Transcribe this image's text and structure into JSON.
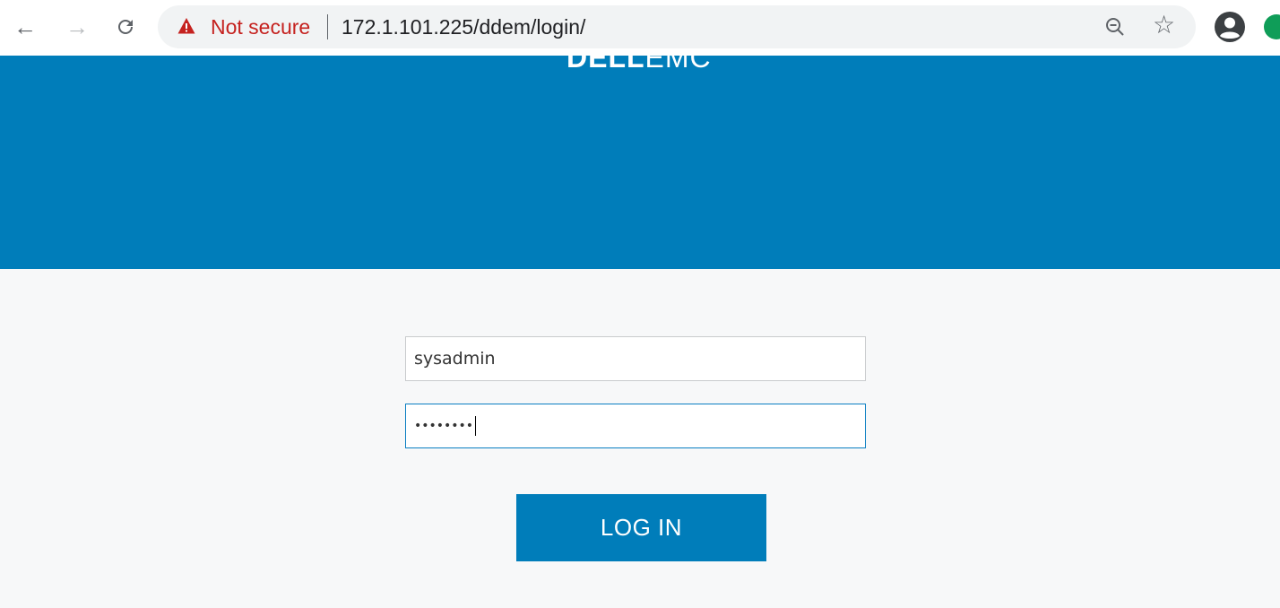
{
  "browser": {
    "back_icon": "arrow-left-icon",
    "forward_icon": "arrow-right-icon",
    "reload_icon": "reload-icon",
    "security_icon": "warning-triangle-icon",
    "security_text": "Not secure",
    "url": "172.1.101.225/ddem/login/",
    "zoom_icon": "zoom-out-icon",
    "bookmark_icon": "star-icon",
    "profile_icon": "profile-icon",
    "colors": {
      "warning": "#c5221f",
      "extension": "#0f9d58"
    }
  },
  "page": {
    "logo_bold": "DELL",
    "logo_light": "EMC",
    "banner_color": "#007dba",
    "username_value": "sysadmin",
    "password_value": "••••••••",
    "login_label": "LOG IN",
    "accent_color": "#007dba"
  }
}
